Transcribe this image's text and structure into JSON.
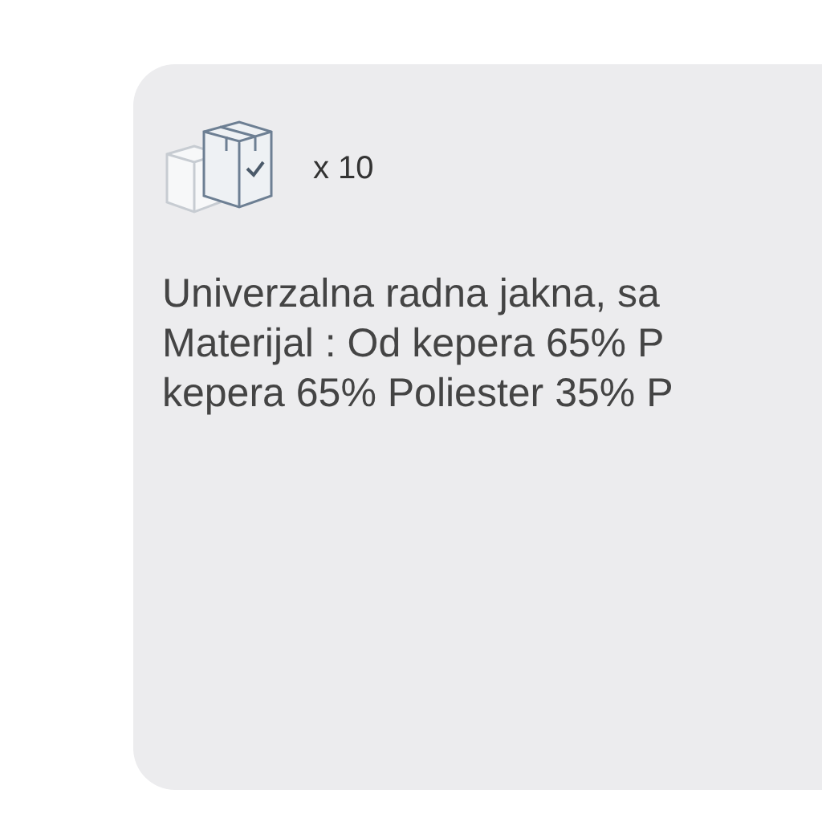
{
  "package": {
    "quantity": "x 10"
  },
  "description_lines": [
    "Univerzalna radna jakna, sa",
    "Materijal : Od kepera 65% P",
    "kepera 65% Poliester 35% P"
  ]
}
